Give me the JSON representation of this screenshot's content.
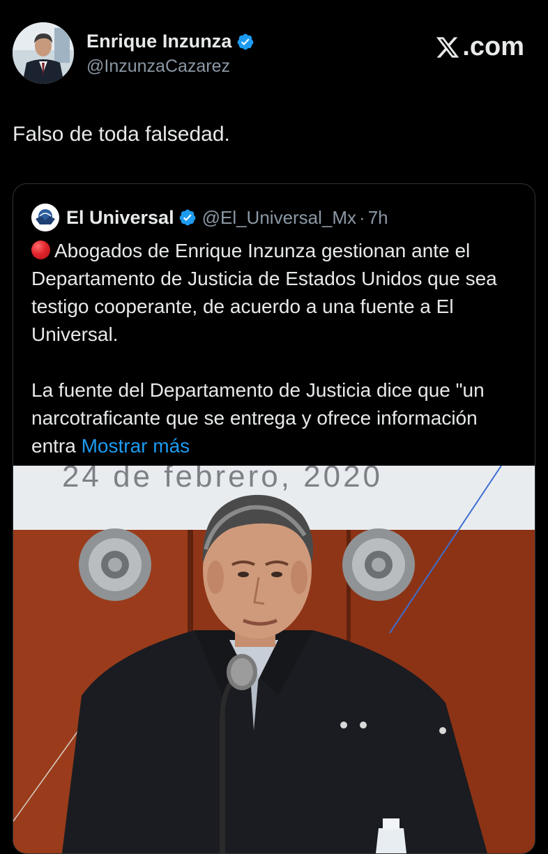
{
  "author": {
    "display_name": "Enrique Inzunza",
    "handle": "@InzunzaCazarez",
    "verified": true
  },
  "brand": {
    "site_label": ".com",
    "logo_icon": "x-logo-icon"
  },
  "tweet": {
    "text": "Falso de toda falsedad."
  },
  "quoted": {
    "display_name": "El Universal",
    "handle": "@El_Universal_Mx",
    "separator": "·",
    "time": "7h",
    "paragraph_1": "Abogados de Enrique Inzunza gestionan ante el Departamento de Justicia de Estados Unidos que sea testigo cooperante, de acuerdo a una fuente a El Universal.",
    "paragraph_2": "La fuente del Departamento de Justicia dice que \"un narcotraficante que se entrega y ofrece información entra",
    "show_more": "Mostrar más",
    "image_banner_text": "24 de febrero, 2020"
  },
  "colors": {
    "background": "#000000",
    "text_primary": "#e7e9ea",
    "text_secondary": "#8b98a5",
    "link": "#1d9bf0",
    "verified": "#1d9bf0",
    "card_border": "#2f3336"
  }
}
